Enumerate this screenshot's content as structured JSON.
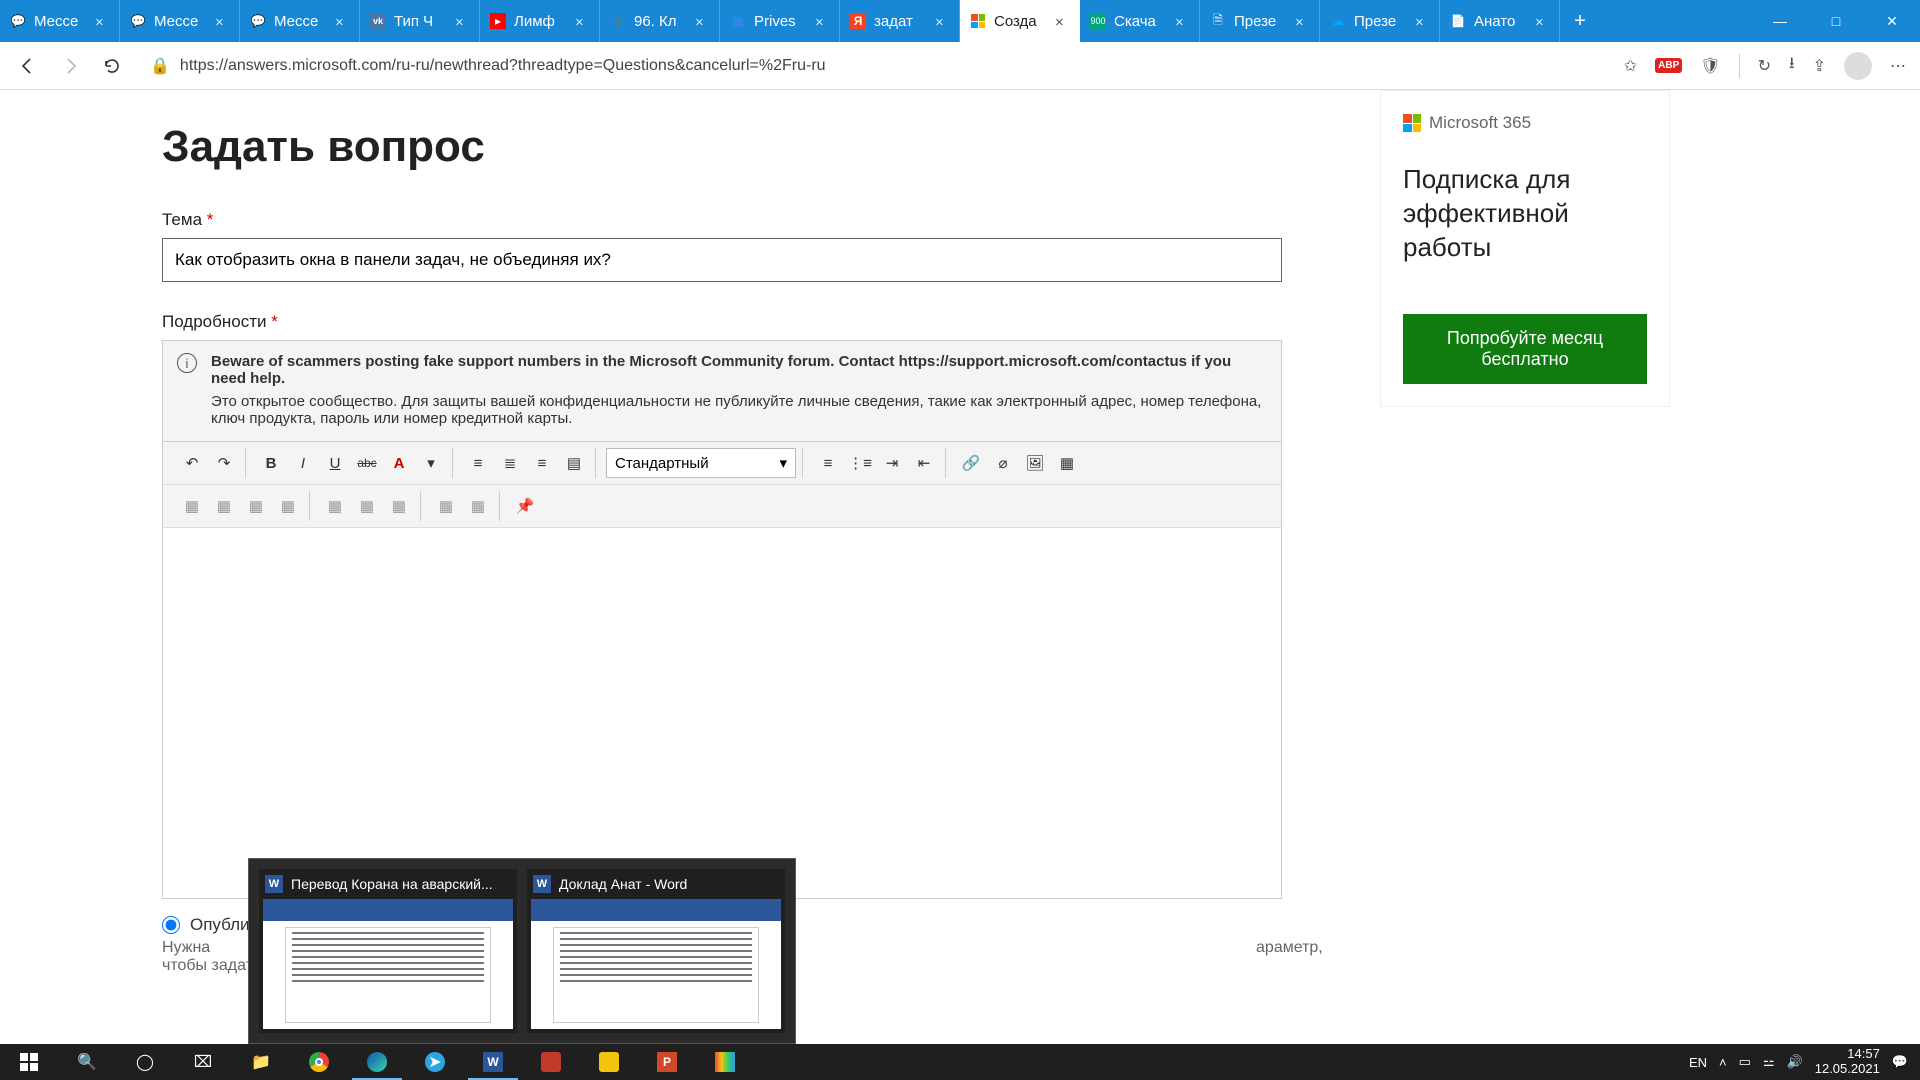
{
  "tabs": [
    {
      "title": "Мессе",
      "close": "×"
    },
    {
      "title": "Мессе",
      "close": "×"
    },
    {
      "title": "Мессе",
      "close": "×"
    },
    {
      "title": "Тип Ч",
      "close": "×"
    },
    {
      "title": "Лимф",
      "close": "×"
    },
    {
      "title": "96. Кл",
      "close": "×"
    },
    {
      "title": "Prives",
      "close": "×"
    },
    {
      "title": "задат",
      "close": "×"
    },
    {
      "title": "Созда",
      "close": "×"
    },
    {
      "title": "Скача",
      "close": "×"
    },
    {
      "title": "Презе",
      "close": "×"
    },
    {
      "title": "Презе",
      "close": "×"
    },
    {
      "title": "Анато",
      "close": "×"
    }
  ],
  "new_tab": "+",
  "win": {
    "min": "—",
    "max": "□",
    "close": "✕"
  },
  "url": "https://answers.microsoft.com/ru-ru/newthread?threadtype=Questions&cancelurl=%2Fru-ru",
  "page": {
    "title": "Задать вопрос",
    "subject_label": "Тема",
    "subject_value": "Как отобразить окна в панели задач, не объединяя их?",
    "details_label": "Подробности",
    "warn_bold": "Beware of scammers posting fake support numbers in the Microsoft Community forum. Contact https://support.microsoft.com/contactus if you need help.",
    "warn_text": "Это открытое сообщество. Для защиты вашей конфиденциальности не публикуйте личные сведения, такие как электронный адрес, номер телефона, ключ продукта, пароль или номер кредитной карты.",
    "style_select": "Стандартный",
    "publish_label": "Опубли",
    "hint_prefix": "Нужна",
    "hint_suffix": "араметр, чтобы задать вопрос сообществу."
  },
  "promo": {
    "brand": "Microsoft 365",
    "headline": "Подписка для эффективной работы",
    "cta": "Попробуйте месяц бесплатно"
  },
  "previews": [
    {
      "title": "Перевод Корана на аварский..."
    },
    {
      "title": "Доклад Анат - Word"
    }
  ],
  "tray": {
    "lang": "EN",
    "time": "14:57",
    "date": "12.05.2021"
  },
  "icons": {
    "abp": "ABP"
  }
}
